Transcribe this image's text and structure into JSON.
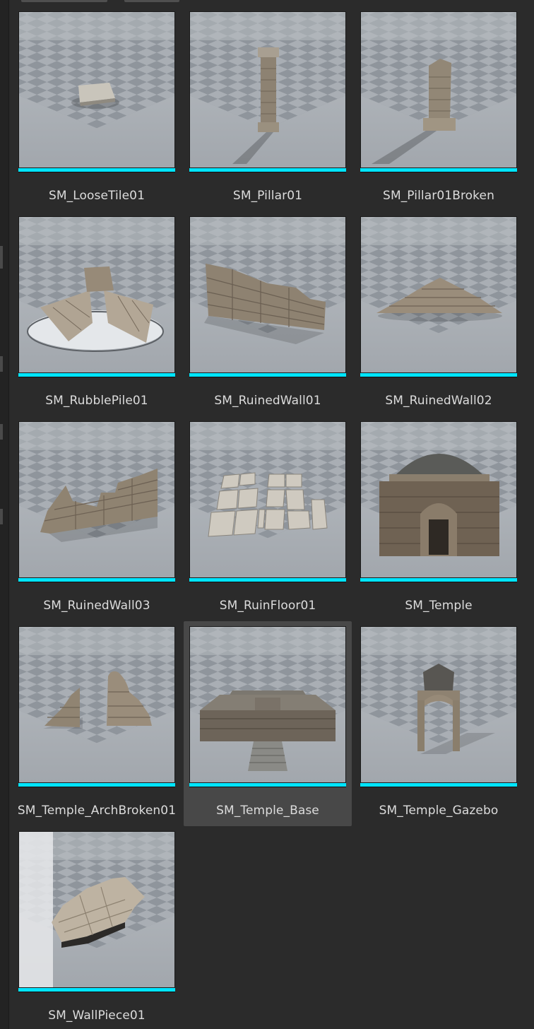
{
  "assets": [
    {
      "name": "SM_LooseTile01",
      "icon": "loose-tile-icon",
      "selected": false
    },
    {
      "name": "SM_Pillar01",
      "icon": "pillar-icon",
      "selected": false
    },
    {
      "name": "SM_Pillar01Broken",
      "icon": "broken-pillar-icon",
      "selected": false
    },
    {
      "name": "SM_RubblePile01",
      "icon": "rubble-pile-icon",
      "selected": false
    },
    {
      "name": "SM_RuinedWall01",
      "icon": "ruined-wall-icon",
      "selected": false
    },
    {
      "name": "SM_RuinedWall02",
      "icon": "ruined-wall-low-icon",
      "selected": false
    },
    {
      "name": "SM_RuinedWall03",
      "icon": "ruined-wall-corner-icon",
      "selected": false
    },
    {
      "name": "SM_RuinFloor01",
      "icon": "ruin-floor-icon",
      "selected": false
    },
    {
      "name": "SM_Temple",
      "icon": "temple-dome-icon",
      "selected": false
    },
    {
      "name": "SM_Temple_ArchBroken01",
      "icon": "broken-arch-icon",
      "selected": false
    },
    {
      "name": "SM_Temple_Base",
      "icon": "temple-base-icon",
      "selected": true
    },
    {
      "name": "SM_Temple_Gazebo",
      "icon": "gazebo-icon",
      "selected": false
    },
    {
      "name": "SM_WallPiece01",
      "icon": "wall-piece-icon",
      "selected": false
    }
  ],
  "colors": {
    "background": "#2b2b2b",
    "asset_type_bar": "#00e5ff",
    "label_text": "#dcdcdc",
    "selected_tile": "#484848"
  }
}
